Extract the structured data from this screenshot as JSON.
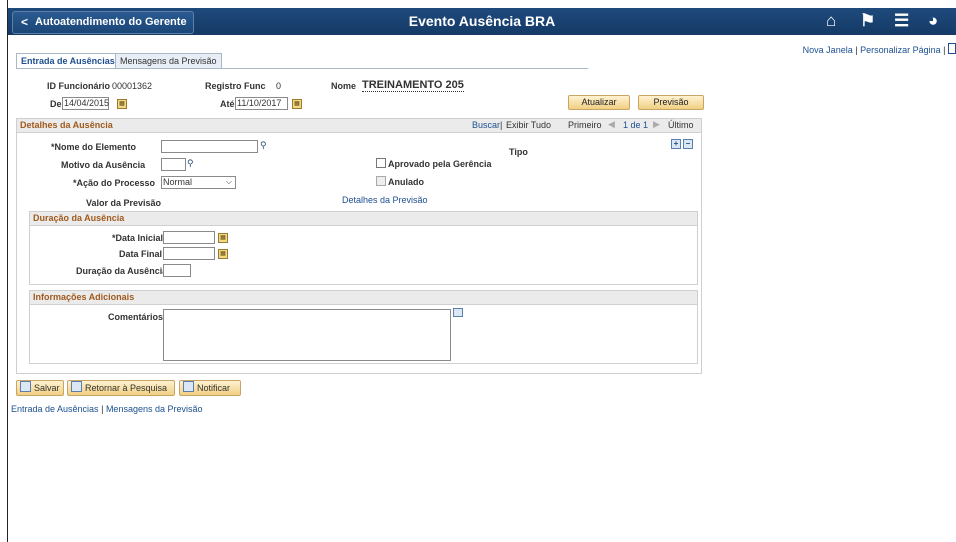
{
  "banner": {
    "back_label": "Autoatendimento do Gerente",
    "title": "Evento Ausência BRA",
    "icons": [
      "home-icon",
      "flag-icon",
      "menu-icon",
      "compass-icon"
    ]
  },
  "top_links": {
    "new_window": "Nova Janela",
    "personalize": "Personalizar Página"
  },
  "tabs": [
    {
      "label": "Entrada de Ausências",
      "active": true
    },
    {
      "label": "Mensagens da Previsão",
      "active": false
    }
  ],
  "header": {
    "employee_id_label": "ID Funcionário",
    "employee_id": "00001362",
    "record_label": "Registro Func",
    "record": "0",
    "name_label": "Nome",
    "name": "TREINAMENTO 205",
    "from_label": "De",
    "from_value": "14/04/2015",
    "to_label": "Até",
    "to_value": "11/10/2017",
    "update_btn": "Atualizar",
    "forecast_btn": "Previsão"
  },
  "details": {
    "title": "Detalhes da Ausência",
    "find": "Buscar",
    "sep": "|",
    "view_all": "Exibir Tudo",
    "first": "Primeiro",
    "page": "1 de 1",
    "last": "Último",
    "element_label": "*Nome do Elemento",
    "element_value": "",
    "reason_label": "Motivo da Ausência",
    "reason_value": "",
    "action_label": "*Ação do Processo",
    "action_value": "Normal",
    "type_label": "Tipo",
    "approved_label": "Aprovado pela Gerência",
    "voided_label": "Anulado",
    "forecast_value_label": "Valor da Previsão",
    "forecast_details_link": "Detalhes da Previsão"
  },
  "duration": {
    "title": "Duração da Ausência",
    "start_label": "*Data Inicial",
    "end_label": "Data Final",
    "duration_label": "Duração da Ausência"
  },
  "additional": {
    "title": "Informações Adicionais",
    "comments_label": "Comentários",
    "comments_value": ""
  },
  "footer": {
    "save": "Salvar",
    "return": "Retornar à Pesquisa",
    "notify": "Notificar",
    "link_entry": "Entrada de Ausências",
    "sep": "|",
    "link_messages": "Mensagens da Previsão"
  }
}
